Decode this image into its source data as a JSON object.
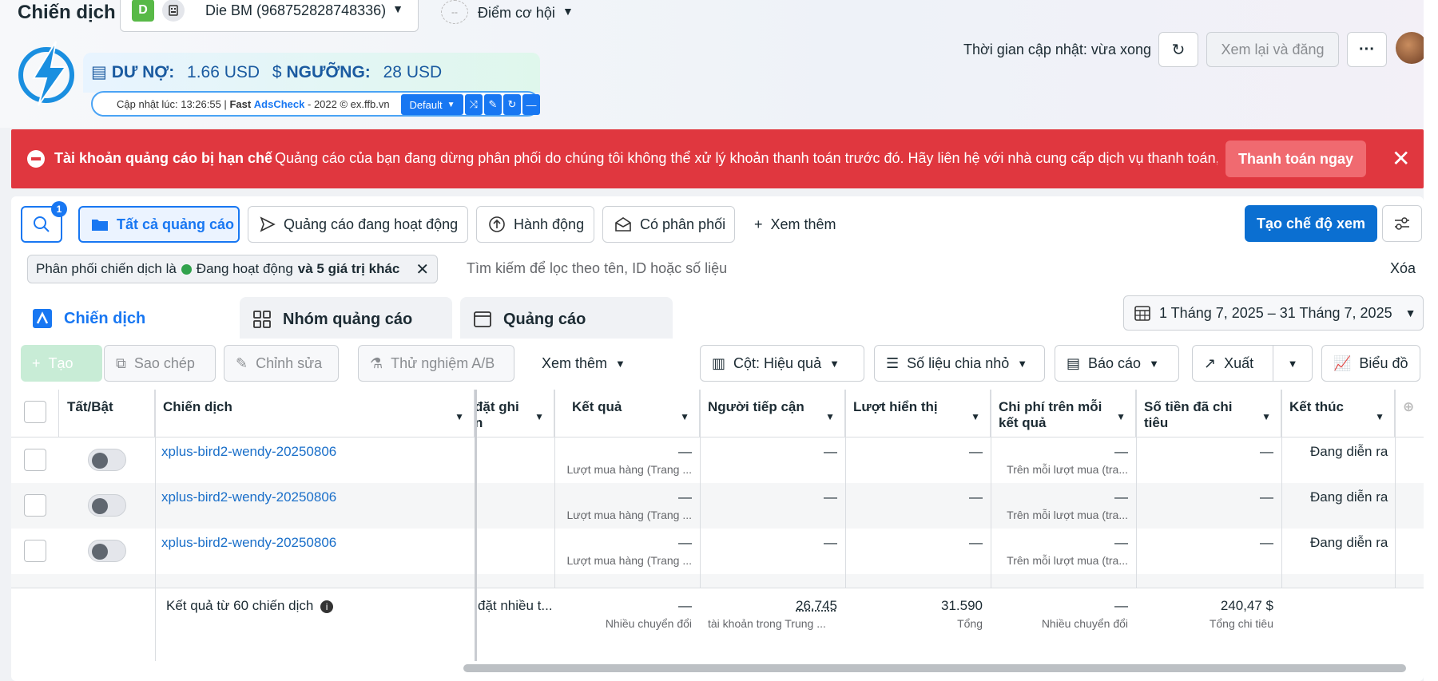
{
  "header": {
    "title": "Chiến dịch",
    "bm_badge": "D",
    "bm_name": "Die BM (968752828748336)",
    "opportunity_icon": "--",
    "opportunity": "Điểm cơ hội",
    "update_time": "Thời gian cập nhật: vừa xong",
    "review_button": "Xem lại và đăng",
    "more_button": "···"
  },
  "adscheck": {
    "debt_label": "DƯ NỢ:",
    "debt_value": "1.66 USD",
    "threshold_label": "NGƯỠNG:",
    "threshold_value": "28 USD",
    "update_prefix": "Cập nhật lúc: 13:26:55 |",
    "brand_fast": "Fast",
    "brand_ads": "AdsCheck",
    "brand_suffix": "- 2022 © ex.ffb.vn",
    "default_label": "Default"
  },
  "alert": {
    "title": "Tài khoản quảng cáo bị hạn chế",
    "message": "Quảng cáo của bạn đang dừng phân phối do chúng tôi không thể xử lý khoản thanh toán trước đó. Hãy liên hệ với nhà cung cấp dịch vụ thanh toán, ...",
    "pay_button": "Thanh toán ngay",
    "color": "#e0373f"
  },
  "filters": {
    "search_badge": "1",
    "all_ads": "Tất cả quảng cáo",
    "active_ads": "Quảng cáo đang hoạt động",
    "actions": "Hành động",
    "delivering": "Có phân phối",
    "see_more": "Xem thêm",
    "create_view": "Tạo chế độ xem"
  },
  "filter_bar": {
    "chip_prefix": "Phân phối chiến dịch là",
    "chip_status": "Đang hoạt động",
    "chip_more": "và 5 giá trị khác",
    "search_placeholder": "Tìm kiếm để lọc theo tên, ID hoặc số liệu",
    "clear": "Xóa"
  },
  "tabs": {
    "campaigns": "Chiến dịch",
    "adsets": "Nhóm quảng cáo",
    "ads": "Quảng cáo",
    "date_range": "1 Tháng 7, 2025 – 31 Tháng 7, 2025"
  },
  "toolbar": {
    "create": "Tạo",
    "duplicate": "Sao chép",
    "edit": "Chỉnh sửa",
    "ab_test": "Thử nghiệm A/B",
    "see_more": "Xem thêm",
    "columns": "Cột: Hiệu quả",
    "breakdown": "Số liệu chia nhỏ",
    "reports": "Báo cáo",
    "export": "Xuất",
    "charts": "Biểu đồ"
  },
  "table": {
    "headers": {
      "toggle": "Tất/Bật",
      "campaign": "Chiến dịch",
      "bid_strategy_a": "đặt ghi",
      "bid_strategy_b": "n",
      "results": "Kết quả",
      "reach": "Người tiếp cận",
      "impressions": "Lượt hiển thị",
      "cost_per_result": "Chi phí trên mỗi kết quả",
      "amount_spent": "Số tiền đã chi tiêu",
      "ends": "Kết thúc"
    },
    "rows": [
      {
        "name": "xplus-bird2-wendy-20250806",
        "results": "—",
        "results_sub": "Lượt mua hàng (Trang ...",
        "reach": "—",
        "impressions": "—",
        "cost": "—",
        "cost_sub": "Trên mỗi lượt mua (tra...",
        "spent": "—",
        "ends": "Đang diễn ra"
      },
      {
        "name": "xplus-bird2-wendy-20250806",
        "results": "—",
        "results_sub": "Lượt mua hàng (Trang ...",
        "reach": "—",
        "impressions": "—",
        "cost": "—",
        "cost_sub": "Trên mỗi lượt mua (tra...",
        "spent": "—",
        "ends": "Đang diễn ra"
      },
      {
        "name": "xplus-bird2-wendy-20250806",
        "results": "—",
        "results_sub": "Lượt mua hàng (Trang ...",
        "reach": "—",
        "impressions": "—",
        "cost": "—",
        "cost_sub": "Trên mỗi lượt mua (tra...",
        "spent": "—",
        "ends": "Đang diễn ra"
      }
    ],
    "footer": {
      "summary": "Kết quả từ 60 chiến dịch",
      "bid": "đặt nhiều t...",
      "results": "—",
      "results_sub": "Nhiều chuyển đổi",
      "reach": "26.745",
      "reach_sub": "tài khoản trong Trung ...",
      "impressions": "31.590",
      "impressions_sub": "Tổng",
      "cost": "—",
      "cost_sub": "Nhiều chuyển đổi",
      "spent": "240,47 $",
      "spent_sub": "Tổng chi tiêu"
    }
  }
}
